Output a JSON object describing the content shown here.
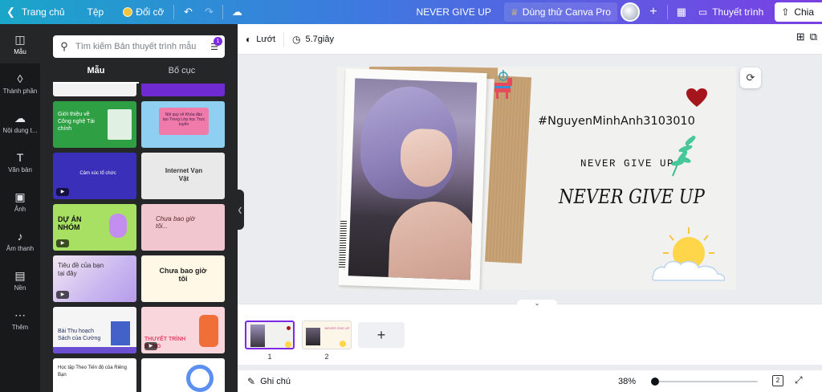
{
  "topbar": {
    "home": "Trang chủ",
    "file": "Tệp",
    "resize": "Đổi cỡ",
    "doc_title": "NEVER GIVE UP",
    "try_pro": "Dùng thử Canva Pro",
    "present": "Thuyết trình",
    "share": "Chia"
  },
  "rail": {
    "items": [
      {
        "label": "Mẫu",
        "icon": "template-icon"
      },
      {
        "label": "Thành phần",
        "icon": "elements-icon"
      },
      {
        "label": "Nội dung t...",
        "icon": "upload-icon"
      },
      {
        "label": "Văn bản",
        "icon": "text-icon"
      },
      {
        "label": "Ảnh",
        "icon": "photo-icon"
      },
      {
        "label": "Âm thanh",
        "icon": "music-icon"
      },
      {
        "label": "Nền",
        "icon": "background-icon"
      },
      {
        "label": "Thêm",
        "icon": "more-icon"
      }
    ]
  },
  "panel": {
    "search_placeholder": "Tìm kiếm Bản thuyết trình mẫu",
    "filter_count": "1",
    "tab_templates": "Mẫu",
    "tab_layouts": "Bố cục",
    "thumbs": [
      {
        "title": "Giới thiệu về Công nghệ Tài chính"
      },
      {
        "title": "Nội quy về Khóa đào tạo Trong Lớp học Trực tuyến"
      },
      {
        "title": "Cảm xúc tổ chức"
      },
      {
        "title": "Internet Vạn Vật"
      },
      {
        "title": "DỰ ÁN NHÓM"
      },
      {
        "title": "Chưa bao giờ tôi..."
      },
      {
        "title": "Tiêu đề của bạn tại đây"
      },
      {
        "title": "Chưa bao giờ tôi"
      },
      {
        "title": "Bài Thu hoạch Sách của Cường"
      },
      {
        "title": "THUYẾT TRÌNH BÀNG"
      },
      {
        "title": "Học tập Theo Tiến độ của Riêng Bạn"
      }
    ]
  },
  "canvas_toolbar": {
    "transition": "Lướt",
    "duration": "5.7giây"
  },
  "slide": {
    "hashtag": "#NguyenMinhAnh3103010",
    "line1": "NEVER GIVE UP",
    "line2": "NEVER GIVE UP"
  },
  "pages": {
    "page1": "1",
    "page2": "2",
    "page2_text": "NEVER GIVE UP"
  },
  "bottombar": {
    "notes": "Ghi chú",
    "zoom": "38%",
    "zoom_fraction": 0.0,
    "page_count": "2"
  },
  "colors": {
    "accent": "#7d2ae8",
    "rail_bg": "#18191b",
    "panel_bg": "#252627"
  }
}
